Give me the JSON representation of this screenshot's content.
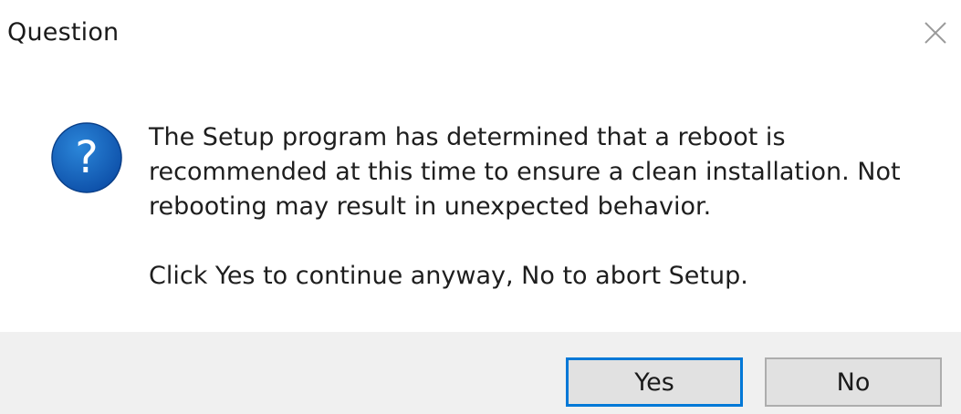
{
  "window": {
    "title": "Question",
    "close_icon": "close-icon"
  },
  "icon": {
    "name": "question-icon",
    "glyph": "?",
    "color": "#1565c0"
  },
  "message": {
    "line1": "The Setup program has determined that a reboot is",
    "line2": "recommended at this time to ensure a clean installation. Not",
    "line3": "rebooting may result in unexpected behavior.",
    "line4": "Click Yes to continue anyway, No to abort Setup."
  },
  "buttons": {
    "yes_label": "Yes",
    "no_label": "No",
    "default_focus_color": "#0078d7"
  }
}
